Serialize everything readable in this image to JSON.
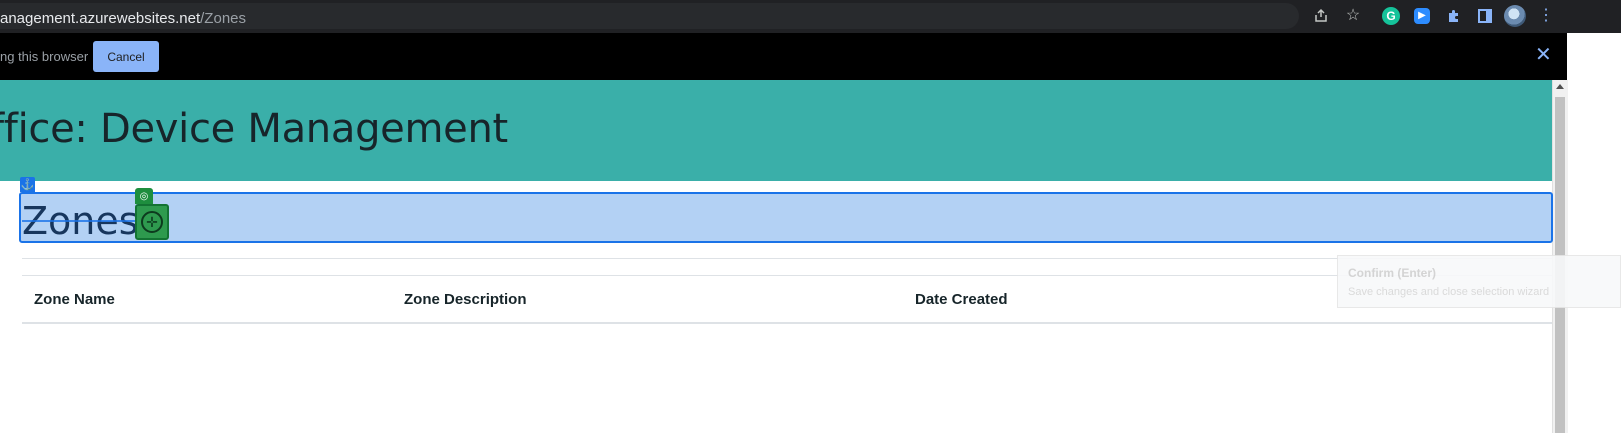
{
  "browser": {
    "url_host": "anagement.azurewebsites.net",
    "url_path": "/Zones",
    "toolbar_icons": [
      "share-icon",
      "star-icon",
      "grammarly-icon",
      "zoom-extension-icon",
      "puzzle-extensions-icon",
      "sidepanel-icon",
      "profile-avatar-icon",
      "more-menu-icon"
    ]
  },
  "banner": {
    "text": "ng this browser",
    "cancel_label": "Cancel",
    "close_glyph": "✕"
  },
  "app": {
    "title": "ffice: Device Management"
  },
  "page": {
    "heading": "Zones"
  },
  "table": {
    "columns": [
      "Zone Name",
      "Zone Description",
      "Date Created"
    ]
  },
  "tooltip": {
    "title": "Confirm (Enter)",
    "description": "Save changes and close selection wizard"
  },
  "colors": {
    "header_bg": "#3aafa9",
    "selection_bg": "#b3d1f4",
    "selection_border": "#1a73e8",
    "target_green": "#2e9a4e",
    "cancel_button": "#8ab4f8"
  }
}
